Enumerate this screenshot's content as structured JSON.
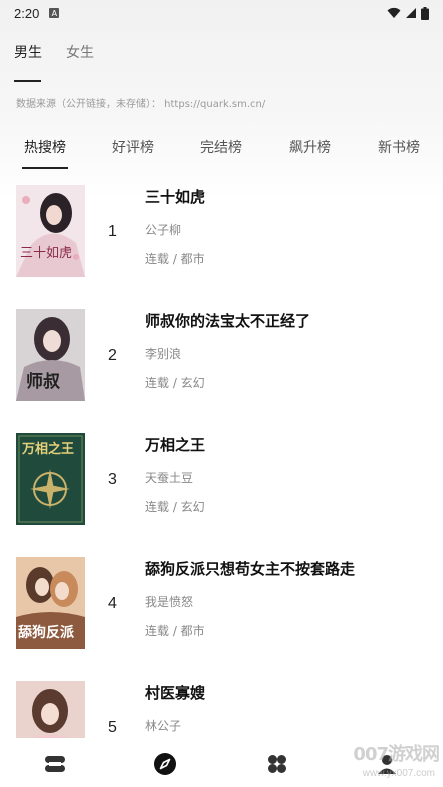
{
  "status": {
    "time": "2:20",
    "badge": "A"
  },
  "gender_tabs": [
    {
      "label": "男生",
      "active": true
    },
    {
      "label": "女生",
      "active": false
    }
  ],
  "source_note": "数据来源（公开链接，未存储）：  https://quark.sm.cn/",
  "rank_tabs": [
    {
      "label": "热搜榜",
      "active": true
    },
    {
      "label": "好评榜",
      "active": false
    },
    {
      "label": "完结榜",
      "active": false
    },
    {
      "label": "飙升榜",
      "active": false
    },
    {
      "label": "新书榜",
      "active": false
    }
  ],
  "books": [
    {
      "rank": "1",
      "title": "三十如虎",
      "author": "公子柳",
      "meta": "连载 / 都市",
      "cover_text": "三十如虎"
    },
    {
      "rank": "2",
      "title": "师叔你的法宝太不正经了",
      "author": "李别浪",
      "meta": "连载 / 玄幻",
      "cover_text": "师叔"
    },
    {
      "rank": "3",
      "title": "万相之王",
      "author": "天蚕土豆",
      "meta": "连载 / 玄幻",
      "cover_text": "万相之王"
    },
    {
      "rank": "4",
      "title": "舔狗反派只想苟女主不按套路走",
      "author": "我是愤怒",
      "meta": "连载 / 都市",
      "cover_text": "舔狗反派"
    },
    {
      "rank": "5",
      "title": "村医寡嫂",
      "author": "林公子",
      "meta": "",
      "cover_text": ""
    }
  ],
  "bottom_nav": [
    {
      "icon": "bookshelf-icon",
      "active": false
    },
    {
      "icon": "discover-compass-icon",
      "active": true
    },
    {
      "icon": "category-icon",
      "active": false
    },
    {
      "icon": "profile-icon",
      "active": false
    }
  ],
  "watermark": {
    "main": "007游戏网",
    "sub": "www.yx007.com"
  },
  "colors": {
    "text": "#222222",
    "muted": "#888888",
    "accent": "#222222"
  }
}
